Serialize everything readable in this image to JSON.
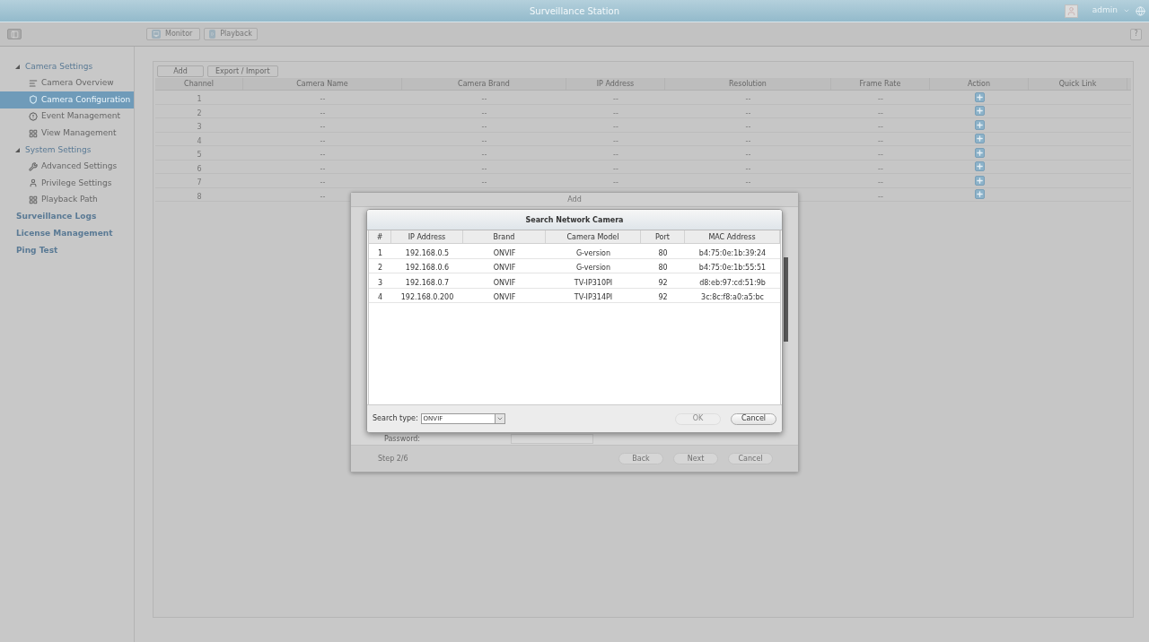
{
  "window": {
    "title": "Surveillance Station",
    "user": "admin"
  },
  "toolbar": {
    "buttons": [
      {
        "label": "Monitor"
      },
      {
        "label": "Playback"
      }
    ],
    "help": "?"
  },
  "sidebar": {
    "items": [
      {
        "label": "Camera Settings",
        "expanded": true,
        "children": [
          {
            "label": "Camera Overview",
            "selected": false
          },
          {
            "label": "Camera Configuration",
            "selected": true
          },
          {
            "label": "Event Management",
            "selected": false
          },
          {
            "label": "View Management",
            "selected": false
          }
        ]
      },
      {
        "label": "System Settings",
        "expanded": true,
        "children": [
          {
            "label": "Advanced Settings",
            "selected": false
          },
          {
            "label": "Privilege Settings",
            "selected": false
          },
          {
            "label": "Playback Path",
            "selected": false
          }
        ]
      },
      {
        "label": "Surveillance Logs"
      },
      {
        "label": "License Management"
      },
      {
        "label": "Ping Test"
      }
    ]
  },
  "camera_table": {
    "buttons": [
      "Add",
      "Export / Import"
    ],
    "columns": [
      "Channel",
      "Camera Name",
      "Camera Brand",
      "IP Address",
      "Resolution",
      "Frame Rate",
      "Action",
      "Quick Link"
    ],
    "rows": [
      {
        "channel": "1",
        "camera_name": "--",
        "camera_brand": "--",
        "ip_address": "--",
        "resolution": "--",
        "frame_rate": "--"
      },
      {
        "channel": "2",
        "camera_name": "--",
        "camera_brand": "--",
        "ip_address": "--",
        "resolution": "--",
        "frame_rate": "--"
      },
      {
        "channel": "3",
        "camera_name": "--",
        "camera_brand": "--",
        "ip_address": "--",
        "resolution": "--",
        "frame_rate": "--"
      },
      {
        "channel": "4",
        "camera_name": "--",
        "camera_brand": "--",
        "ip_address": "--",
        "resolution": "--",
        "frame_rate": "--"
      },
      {
        "channel": "5",
        "camera_name": "--",
        "camera_brand": "--",
        "ip_address": "--",
        "resolution": "--",
        "frame_rate": "--"
      },
      {
        "channel": "6",
        "camera_name": "--",
        "camera_brand": "--",
        "ip_address": "--",
        "resolution": "--",
        "frame_rate": "--"
      },
      {
        "channel": "7",
        "camera_name": "--",
        "camera_brand": "--",
        "ip_address": "--",
        "resolution": "--",
        "frame_rate": "--"
      },
      {
        "channel": "8",
        "camera_name": "--",
        "frame_rate": "--"
      }
    ]
  },
  "add_dialog": {
    "title": "Add",
    "password_label": "Password:",
    "step": "Step 2/6",
    "buttons": [
      {
        "label": "Back",
        "disabled": true
      },
      {
        "label": "Next",
        "disabled": true
      },
      {
        "label": "Cancel",
        "disabled": true
      }
    ]
  },
  "search_dialog": {
    "title": "Search Network Camera",
    "columns": [
      "#",
      "IP Address",
      "Brand",
      "Camera Model",
      "Port",
      "MAC Address"
    ],
    "rows": [
      {
        "index": "1",
        "ip": "192.168.0.5",
        "brand": "ONVIF",
        "model": "G-version",
        "port": "80",
        "mac": "b4:75:0e:1b:39:24"
      },
      {
        "index": "2",
        "ip": "192.168.0.6",
        "brand": "ONVIF",
        "model": "G-version",
        "port": "80",
        "mac": "b4:75:0e:1b:55:51"
      },
      {
        "index": "3",
        "ip": "192.168.0.7",
        "brand": "ONVIF",
        "model": "TV-IP310PI",
        "port": "92",
        "mac": "d8:eb:97:cd:51:9b"
      },
      {
        "index": "4",
        "ip": "192.168.0.200",
        "brand": "ONVIF",
        "model": "TV-IP314PI",
        "port": "92",
        "mac": "3c:8c:f8:a0:a5:bc"
      }
    ],
    "search_type_label": "Search type:",
    "search_type": "ONVIF",
    "buttons": [
      {
        "label": "OK",
        "disabled": true
      },
      {
        "label": "Cancel",
        "disabled": false
      }
    ]
  }
}
